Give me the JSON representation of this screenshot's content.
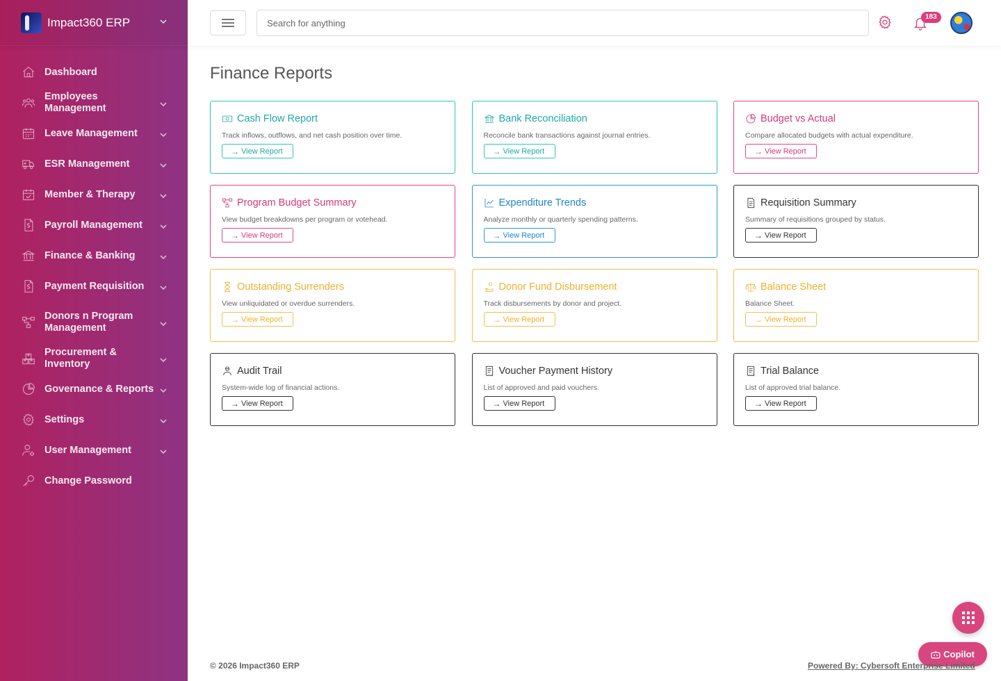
{
  "app": {
    "name": "Impact360 ERP"
  },
  "sidebar": {
    "items": [
      {
        "label": "Dashboard",
        "icon": "home-icon",
        "has_children": false
      },
      {
        "label": "Employees Management",
        "icon": "users-icon",
        "has_children": true
      },
      {
        "label": "Leave Management",
        "icon": "calendar-icon",
        "has_children": true
      },
      {
        "label": "ESR Management",
        "icon": "truck-icon",
        "has_children": true
      },
      {
        "label": "Member & Therapy",
        "icon": "calendar-check-icon",
        "has_children": true
      },
      {
        "label": "Payroll Management",
        "icon": "dollar-file-icon",
        "has_children": true
      },
      {
        "label": "Finance & Banking",
        "icon": "bank-icon",
        "has_children": true
      },
      {
        "label": "Payment Requisition",
        "icon": "dollar-file-icon",
        "has_children": true
      },
      {
        "label": "Donors n Program Management",
        "icon": "diagram-icon",
        "has_children": true
      },
      {
        "label": "Procurement & Inventory",
        "icon": "boxes-icon",
        "has_children": true
      },
      {
        "label": "Governance & Reports",
        "icon": "pie-chart-icon",
        "has_children": true
      },
      {
        "label": "Settings",
        "icon": "gear-icon",
        "has_children": true
      },
      {
        "label": "User Management",
        "icon": "user-gear-icon",
        "has_children": true
      },
      {
        "label": "Change Password",
        "icon": "key-icon",
        "has_children": false
      }
    ]
  },
  "header": {
    "search_placeholder": "Search for anything",
    "notification_count": "183"
  },
  "main": {
    "title": "Finance Reports",
    "button_label": "View Report",
    "cards": [
      {
        "title": "Cash Flow Report",
        "desc": "Track inflows, outflows, and net cash position over time.",
        "color": "teal",
        "icon": "cash-icon"
      },
      {
        "title": "Bank Reconciliation",
        "desc": "Reconcile bank transactions against journal entries.",
        "color": "teal",
        "icon": "bank-icon"
      },
      {
        "title": "Budget vs Actual",
        "desc": "Compare allocated budgets with actual expenditure.",
        "color": "pink",
        "icon": "pie-chart-icon"
      },
      {
        "title": "Program Budget Summary",
        "desc": "View budget breakdowns per program or votehead.",
        "color": "pink",
        "icon": "diagram-icon"
      },
      {
        "title": "Expenditure Trends",
        "desc": "Analyze monthly or quarterly spending patterns.",
        "color": "blue",
        "icon": "trend-icon"
      },
      {
        "title": "Requisition Summary",
        "desc": "Summary of requisitions grouped by status.",
        "color": "dark",
        "icon": "document-icon"
      },
      {
        "title": "Outstanding Surrenders",
        "desc": "View unliquidated or overdue surrenders.",
        "color": "amber",
        "icon": "hourglass-icon"
      },
      {
        "title": "Donor Fund Disbursement",
        "desc": "Track disbursements by donor and project.",
        "color": "amber",
        "icon": "hand-coin-icon"
      },
      {
        "title": "Balance Sheet",
        "desc": "Balance Sheet.",
        "color": "amber",
        "icon": "scale-icon"
      },
      {
        "title": "Audit Trail",
        "desc": "System-wide log of financial actions.",
        "color": "dark",
        "icon": "user-lock-icon"
      },
      {
        "title": "Voucher Payment History",
        "desc": "List of approved and paid vouchers.",
        "color": "dark",
        "icon": "receipt-icon"
      },
      {
        "title": "Trial Balance",
        "desc": "List of approved trial balance.",
        "color": "dark",
        "icon": "receipt-icon"
      }
    ]
  },
  "floating": {
    "copilot_label": "Copilot"
  },
  "footer": {
    "copyright": "© 2026 Impact360 ERP",
    "powered_by": "Powered By: Cybersoft Enterprise Limited"
  },
  "colors": {
    "teal": "#2ec3c2",
    "pink": "#e2468a",
    "blue": "#2997dd",
    "dark": "#333333",
    "amber": "#f5c04a",
    "sidebar_start": "#b0215f",
    "sidebar_end": "#8e3383"
  }
}
